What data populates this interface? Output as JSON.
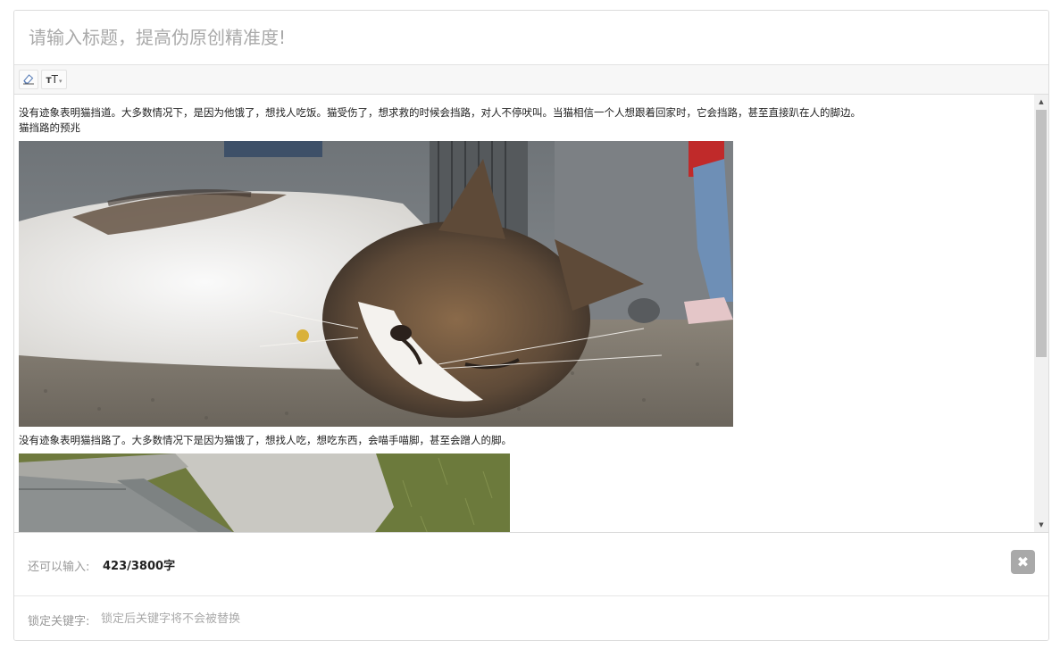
{
  "title": {
    "placeholder": "请输入标题，提高伪原创精准度!"
  },
  "toolbar": {
    "eraser_icon": "eraser-icon",
    "font_size_icon": "font-size-icon",
    "font_size_small": "T",
    "font_size_large": "T",
    "caret": "▾"
  },
  "editor": {
    "paragraphs": [
      "没有迹象表明猫挡道。大多数情况下，是因为他饿了，想找人吃饭。猫受伤了，想求救的时候会挡路，对人不停吠叫。当猫相信一个人想跟着回家时，它会挡路，甚至直接趴在人的脚边。",
      "猫挡路的预兆",
      "没有迹象表明猫挡路了。大多数情况下是因为猫饿了，想找人吃，想吃东西，会喵手喵脚，甚至会蹭人的脚。"
    ],
    "images": [
      {
        "name": "cat-sleeping-image"
      },
      {
        "name": "grass-curb-image"
      }
    ]
  },
  "scrollbar": {
    "up_arrow": "▲",
    "down_arrow": "▼"
  },
  "resize_handle": "÷",
  "count": {
    "label": "还可以输入:",
    "value": "423/3800字",
    "clear_icon": "✖"
  },
  "keywords": {
    "label": "锁定关键字:",
    "placeholder": "锁定后关键字将不会被替换"
  }
}
